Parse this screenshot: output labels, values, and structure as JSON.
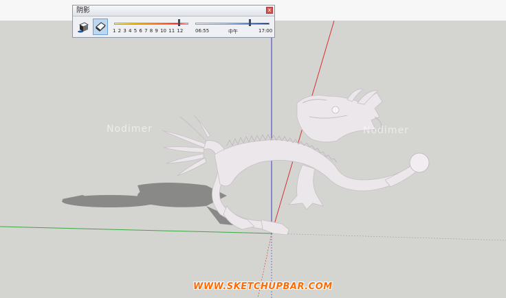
{
  "panel": {
    "title": "阴影",
    "close_glyph": "x",
    "display_shadows_icon": "shadow-display-icon",
    "face_shadow_icon": "face-shadow-icon",
    "month_ticks": "1 2 3 4 5 6 7 8 9 10 11 12",
    "time_start": "06:55",
    "time_mid": "中午",
    "time_end": "17:00",
    "month_fraction": 0.86,
    "time_fraction": 0.72
  },
  "watermarks": [
    "Nodimer",
    "Nodimer"
  ],
  "site": {
    "url": "WWW.SKETCHUPBAR.COM"
  },
  "colors": {
    "ground": "#d4d4d0",
    "sky": "#f7f7f7",
    "axis_red": "#d43030",
    "axis_green": "#3fa542",
    "axis_blue": "#3a3ad0",
    "dragon": "#ece7eb",
    "shadow": "#7c7c7c",
    "url": "#ff6a00"
  }
}
